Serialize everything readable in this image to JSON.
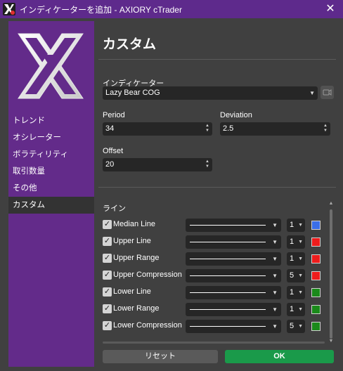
{
  "window": {
    "title": "インディケーターを追加 - AXIORY cTrader",
    "close_glyph": "✕"
  },
  "sidebar": {
    "items": [
      {
        "label": "トレンド"
      },
      {
        "label": "オシレーター"
      },
      {
        "label": "ボラティリティ"
      },
      {
        "label": "取引数量"
      },
      {
        "label": "その他"
      },
      {
        "label": "カスタム",
        "active": true
      }
    ]
  },
  "main": {
    "heading": "カスタム",
    "indicator": {
      "label": "インディケーター",
      "value": "Lazy Bear COG"
    },
    "period": {
      "label": "Period",
      "value": "34"
    },
    "deviation": {
      "label": "Deviation",
      "value": "2.5"
    },
    "offset": {
      "label": "Offset",
      "value": "20"
    },
    "lines_label": "ライン",
    "lines": [
      {
        "label": "Median Line",
        "checked": true,
        "width": "1",
        "color": "#3a6ee8"
      },
      {
        "label": "Upper Line",
        "checked": true,
        "width": "1",
        "color": "#ee1c1c"
      },
      {
        "label": "Upper Range",
        "checked": true,
        "width": "1",
        "color": "#ee1c1c"
      },
      {
        "label": "Upper Compression",
        "checked": true,
        "width": "5",
        "color": "#ee1c1c"
      },
      {
        "label": "Lower Line",
        "checked": true,
        "width": "1",
        "color": "#1a8a1a"
      },
      {
        "label": "Lower Range",
        "checked": true,
        "width": "1",
        "color": "#1a8a1a"
      },
      {
        "label": "Lower Compression",
        "checked": true,
        "width": "5",
        "color": "#1a8a1a"
      }
    ]
  },
  "footer": {
    "reset_label": "リセット",
    "ok_label": "OK"
  },
  "colors": {
    "title_bar": "#5e2a8c",
    "sidebar": "#632b8a",
    "background": "#404040",
    "ok_button": "#1a9a4a"
  }
}
